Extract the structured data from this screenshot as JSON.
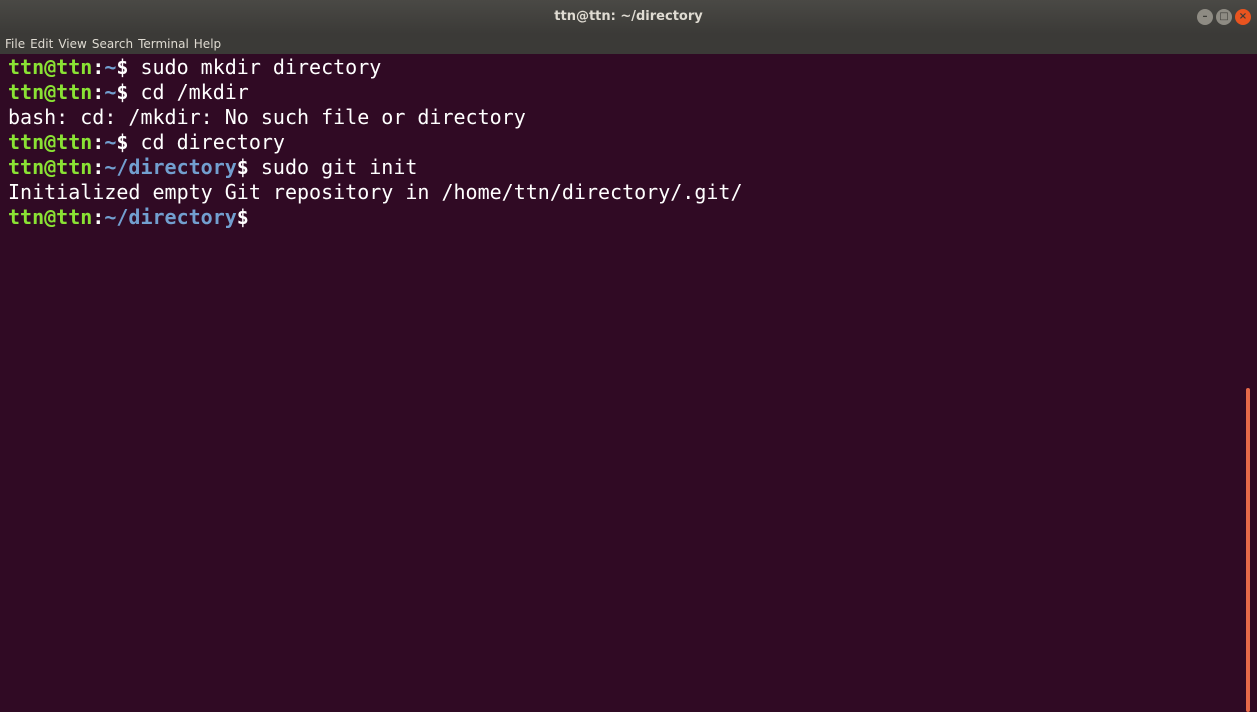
{
  "window": {
    "title": "ttn@ttn: ~/directory",
    "controls": {
      "minimize_icon": "minimize-icon",
      "maximize_icon": "maximize-icon",
      "close_icon": "close-icon"
    }
  },
  "menu": {
    "items": [
      "File",
      "Edit",
      "View",
      "Search",
      "Terminal",
      "Help"
    ]
  },
  "terminal": {
    "lines": [
      {
        "type": "prompt",
        "user": "ttn@ttn",
        "sep": ":",
        "path": "~",
        "symbol": "$",
        "command": " sudo mkdir directory"
      },
      {
        "type": "prompt",
        "user": "ttn@ttn",
        "sep": ":",
        "path": "~",
        "symbol": "$",
        "command": " cd /mkdir"
      },
      {
        "type": "output",
        "text": "bash: cd: /mkdir: No such file or directory"
      },
      {
        "type": "prompt",
        "user": "ttn@ttn",
        "sep": ":",
        "path": "~",
        "symbol": "$",
        "command": " cd directory"
      },
      {
        "type": "prompt",
        "user": "ttn@ttn",
        "sep": ":",
        "path": "~/directory",
        "symbol": "$",
        "command": " sudo git init"
      },
      {
        "type": "output",
        "text": "Initialized empty Git repository in /home/ttn/directory/.git/"
      },
      {
        "type": "prompt",
        "user": "ttn@ttn",
        "sep": ":",
        "path": "~/directory",
        "symbol": "$",
        "command": ""
      }
    ]
  },
  "colors": {
    "background": "#300a24",
    "prompt_user": "#8ae234",
    "prompt_path": "#729fcf",
    "text": "#ffffff",
    "close_button": "#e9541f"
  }
}
